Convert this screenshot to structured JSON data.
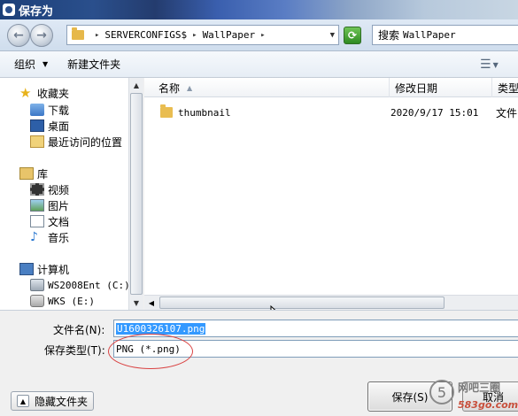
{
  "window": {
    "title": "保存为"
  },
  "address": {
    "segments": [
      "SERVERCONFIGS$",
      "WallPaper"
    ],
    "search_label": "搜索",
    "search_scope": "WallPaper"
  },
  "toolbar": {
    "organize": "组织",
    "new_folder": "新建文件夹"
  },
  "nav": {
    "favorites": "收藏夹",
    "downloads": "下载",
    "desktop": "桌面",
    "recent": "最近访问的位置",
    "libraries": "库",
    "videos": "视频",
    "pictures": "图片",
    "documents": "文档",
    "music": "音乐",
    "computer": "计算机",
    "drive_c": "WS2008Ent (C:)",
    "drive_e": "WKS (E:)"
  },
  "files": {
    "columns": {
      "name": "名称",
      "date": "修改日期",
      "type": "类型"
    },
    "rows": [
      {
        "name": "thumbnail",
        "date": "2020/9/17 15:01",
        "type": "文件"
      }
    ]
  },
  "form": {
    "filename_label": "文件名(N):",
    "filename_value": "U1600326107.png",
    "filetype_label": "保存类型(T):",
    "filetype_value": "PNG (*.png)",
    "hide_folders": "隐藏文件夹",
    "save": "保存(S)",
    "cancel": "取消"
  },
  "watermark": {
    "digit": "5",
    "cn": "网吧三圈",
    "site": "583go.com"
  },
  "colors": {
    "accent": "#3399ff",
    "annotation": "#d94040"
  }
}
